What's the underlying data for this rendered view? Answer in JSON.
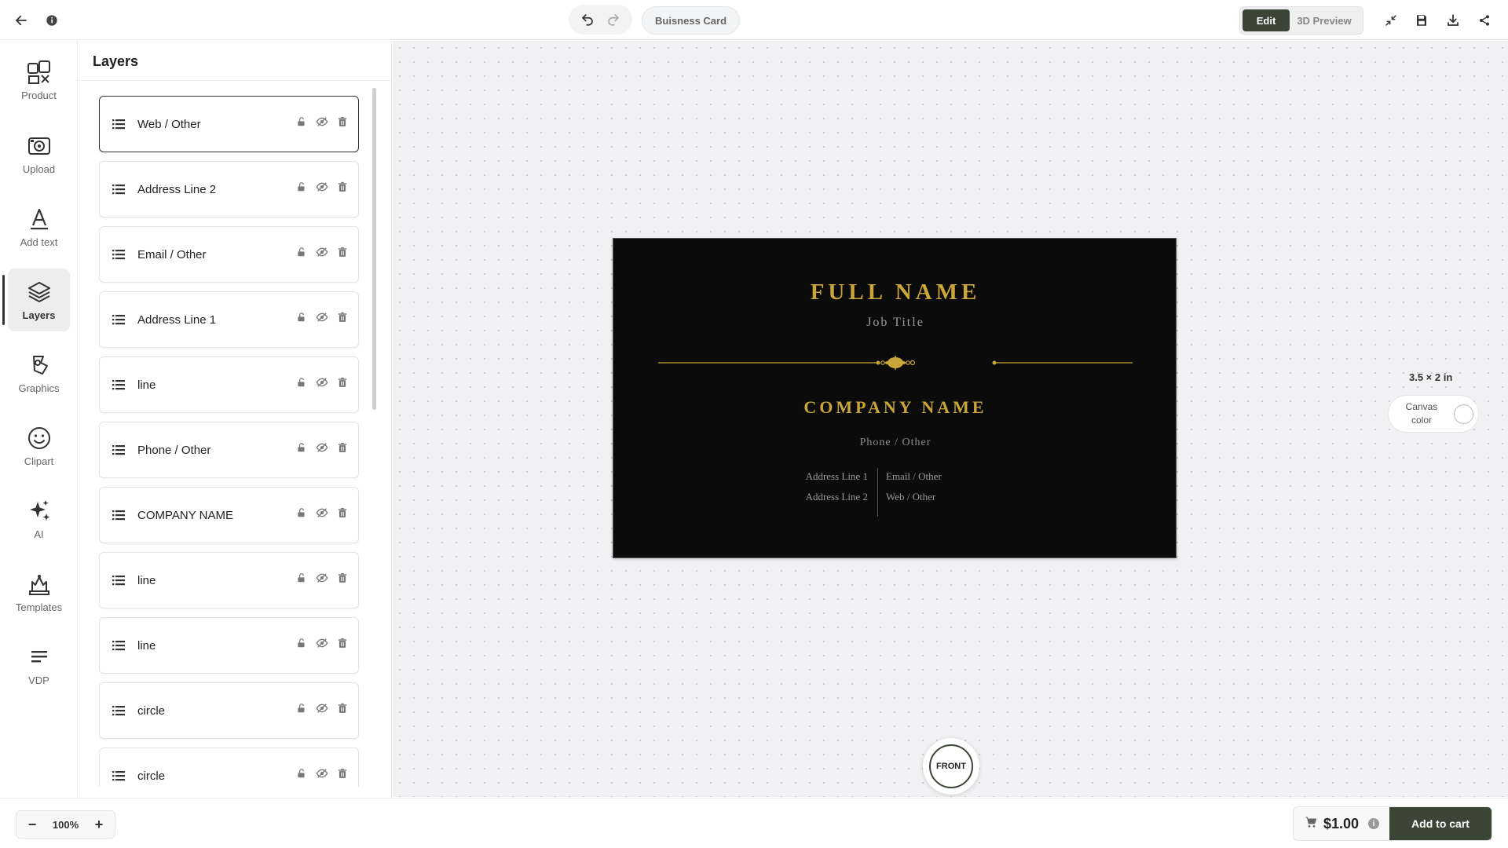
{
  "header": {
    "back_icon": "arrow-left-icon",
    "info_icon": "info-icon",
    "undo_icon": "undo-icon",
    "redo_icon": "redo-icon",
    "document_title": "Buisness Card",
    "modes": {
      "edit": "Edit",
      "preview": "3D Preview"
    },
    "tools": [
      "collapse-icon",
      "save-icon",
      "download-icon",
      "share-icon"
    ]
  },
  "rail": {
    "items": [
      {
        "label": "Product",
        "icon": "product-icon"
      },
      {
        "label": "Upload",
        "icon": "upload-icon"
      },
      {
        "label": "Add text",
        "icon": "text-icon"
      },
      {
        "label": "Layers",
        "icon": "layers-icon",
        "active": true
      },
      {
        "label": "Graphics",
        "icon": "graphics-icon"
      },
      {
        "label": "Clipart",
        "icon": "smiley-icon"
      },
      {
        "label": "AI",
        "icon": "sparkles-icon"
      },
      {
        "label": "Templates",
        "icon": "templates-icon"
      },
      {
        "label": "VDP",
        "icon": "lines-icon"
      }
    ]
  },
  "layers": {
    "title": "Layers",
    "items": [
      {
        "name": "Web / Other",
        "selected": true
      },
      {
        "name": "Address Line 2"
      },
      {
        "name": "Email / Other"
      },
      {
        "name": "Address Line 1"
      },
      {
        "name": "line"
      },
      {
        "name": "Phone / Other"
      },
      {
        "name": "COMPANY NAME"
      },
      {
        "name": "line"
      },
      {
        "name": "line"
      },
      {
        "name": "circle"
      },
      {
        "name": "circle"
      }
    ]
  },
  "card": {
    "full_name": "FULL NAME",
    "job_title": "Job Title",
    "company_name": "COMPANY NAME",
    "phone": "Phone / Other",
    "address_line_1": "Address Line 1",
    "address_line_2": "Address Line 2",
    "email": "Email / Other",
    "web": "Web / Other",
    "background_color": "#0b0b0b",
    "accent_color": "#c9a53a"
  },
  "canvas": {
    "size_label": "3.5 × 2 in",
    "canvas_color_label": "Canvas color",
    "side_label": "FRONT"
  },
  "footer": {
    "zoom_out": "−",
    "zoom_in": "+",
    "zoom_value": "100%",
    "price": "$1.00",
    "price_info": "i",
    "add_to_cart": "Add to cart"
  },
  "colors": {
    "primary": "#3a4536",
    "accent": "#c9a53a"
  }
}
